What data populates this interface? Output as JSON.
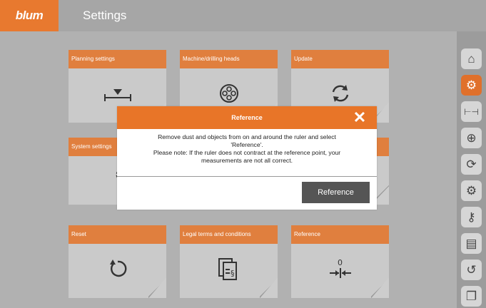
{
  "header": {
    "logo": "blum",
    "title": "Settings"
  },
  "tiles": [
    {
      "label": "Planning settings",
      "icon": "planning-icon"
    },
    {
      "label": "Machine/drilling heads",
      "icon": "drill-head-icon"
    },
    {
      "label": "Update",
      "icon": "update-icon"
    },
    {
      "label": "System settings",
      "icon": "gears-icon"
    },
    {
      "label": "",
      "icon": ""
    },
    {
      "label": "",
      "icon": ""
    },
    {
      "label": "Reset",
      "icon": "reset-icon"
    },
    {
      "label": "Legal terms and conditions",
      "icon": "legal-icon"
    },
    {
      "label": "Reference",
      "icon": "reference-icon"
    }
  ],
  "sidebar": {
    "items": [
      {
        "icon": "home-icon"
      },
      {
        "icon": "settings-gear-icon",
        "active": true
      },
      {
        "icon": "ruler-icon"
      },
      {
        "icon": "zoom-in-icon"
      },
      {
        "icon": "refresh-icon"
      },
      {
        "icon": "gears-icon"
      },
      {
        "icon": "key-icon"
      },
      {
        "icon": "clipboard-icon"
      },
      {
        "icon": "reset-icon"
      },
      {
        "icon": "legal-icon"
      }
    ]
  },
  "modal": {
    "title": "Reference",
    "message_line1": "Remove dust and objects from on and around the ruler and select",
    "message_line2": "'Reference'.",
    "message_line3": "Please note: If the ruler does not contract at the reference point, your",
    "message_line4": "measurements are not all correct.",
    "button_label": "Reference",
    "close_symbol": "✕"
  },
  "reference_tile_value": "0",
  "colors": {
    "accent": "#e87528",
    "button": "#555555"
  }
}
